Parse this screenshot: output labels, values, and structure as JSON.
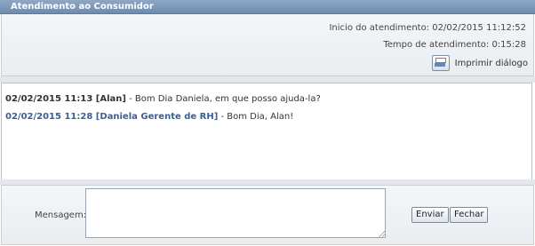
{
  "window": {
    "title": "Atendimento ao Consumidor"
  },
  "info": {
    "start_label": "Inicio do atendimento:",
    "start_value": "02/02/2015 11:12:52",
    "duration_label": "Tempo de atendimento:",
    "duration_value": "0:15:28",
    "print_label": "Imprimir diálogo"
  },
  "chat": {
    "messages": [
      {
        "stamp": "02/02/2015 11:13 [Alan]",
        "text": " - Bom Dia Daniela, em que posso ajuda-la?"
      },
      {
        "stamp": "02/02/2015 11:28 [Daniela Gerente de RH]",
        "text": " - Bom Dia, Alan!"
      }
    ]
  },
  "compose": {
    "label": "Mensagem:",
    "value": "",
    "send_label": "Enviar",
    "close_label": "Fechar"
  },
  "colors": {
    "titlebar": "#7893b6",
    "agent_stamp": "#3a5f95"
  }
}
